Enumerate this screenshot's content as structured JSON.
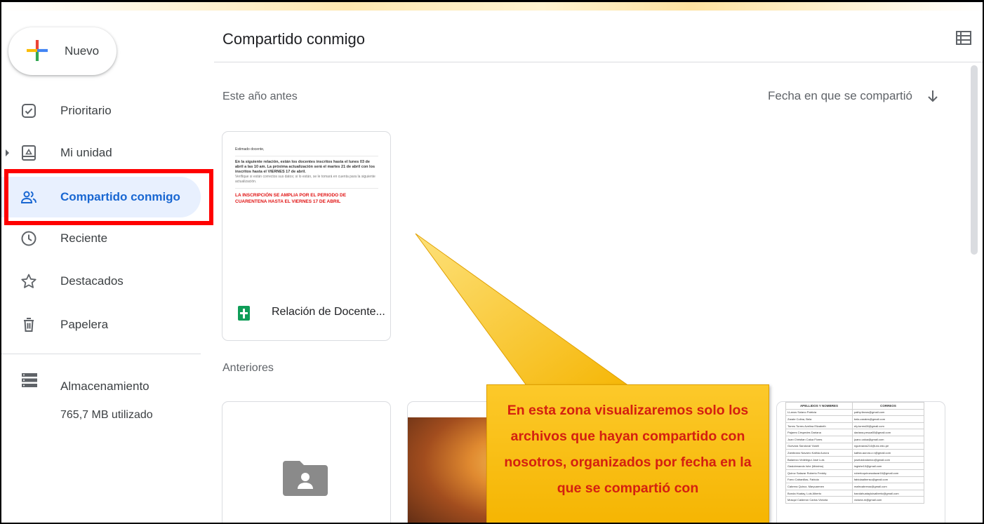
{
  "sidebar": {
    "new_button": "Nuevo",
    "items": [
      {
        "label": "Prioritario",
        "icon": "priority-check-icon"
      },
      {
        "label": "Mi unidad",
        "icon": "drive-icon"
      },
      {
        "label": "Compartido conmigo",
        "icon": "shared-people-icon",
        "active": true
      },
      {
        "label": "Reciente",
        "icon": "clock-icon"
      },
      {
        "label": "Destacados",
        "icon": "star-icon"
      },
      {
        "label": "Papelera",
        "icon": "trash-icon"
      }
    ],
    "storage": {
      "label": "Almacenamiento",
      "used": "765,7 MB utilizado"
    }
  },
  "main": {
    "title": "Compartido conmigo",
    "section_recent": "Este año antes",
    "sort_label": "Fecha en que se compartió",
    "section_older": "Anteriores",
    "files": [
      {
        "name": "Relación de Docente...",
        "type": "sheets"
      }
    ]
  },
  "doc_preview": {
    "line1": "Estimado docente,",
    "line2": "En la siguiente relación, están los docentes inscritos hasta el lunes 03 de abril a las 10 am. La próxima actualización será el martes 21 de abril con los inscritos hasta el VIERNES 17 de abril.",
    "line3": "Verifique si están correctos sus datos; si lo están, se le tomará en cuenta para la siguiente actualización.",
    "red_text": "LA INSCRIPCIÓN SE AMPLIA POR EL PERIODO DE CUARENTENA HASTA EL VIERNES 17 DE ABRIL"
  },
  "sheet_preview": {
    "headers": [
      "APELLIDOS Y NOMBRES",
      "CORREOS"
    ],
    "rows": [
      [
        "LLanos Solano Patricia",
        "pathy.llanos@gmail.com"
      ],
      [
        "Zarate Colina, Bela",
        "bela.zarates@gmail.com"
      ],
      [
        "Torres Torres Avelina Elizabeth",
        "ely.torres08@gmail.com"
      ],
      [
        "Pajares Céspedes Dariana",
        "dariana.pesua65@gmail.com"
      ],
      [
        "Juan Christian Calua Flores",
        "juanc.calua@gmail.com"
      ],
      [
        "Guevara Sandoval Yaneli",
        "nguevaras214@unc.edu.pe"
      ],
      [
        "Zambrano Navarro Kathia Aurora",
        "kathia.aurora.z.n@gmail.com"
      ],
      [
        "Balarezo Vedelegui José Luis",
        "joseluisbalarezo@gmail.com"
      ],
      [
        "Gaslobmando Ishe (Máximo)",
        "ingishe10@gmail.com"
      ],
      [
        "Quiroz Salazar Roberto Freddy",
        "robertoquirozsalazar16@gmail.com"
      ],
      [
        "Farro Cabanillas, Fabiola",
        "fabiolaalbenso@gmail.com"
      ],
      [
        "Cabrera Quiroz, Maryuarmen",
        "mafecabreraz@gmail.com"
      ],
      [
        "Bonda Huatay, Luis Alberto",
        "bandahuatayluisalberto@gmail.com"
      ],
      [
        "Mosqui Calderon Carlos Victoria",
        "victoria.m@gmail.com"
      ]
    ]
  },
  "callout": {
    "text": "En esta zona visualizaremos solo los archivos que hayan compartido con nosotros, organizados por fecha en la que se compartió con"
  },
  "colors": {
    "accent": "#1967d2",
    "highlight_box": "#ff0000",
    "callout_fill": "#f9bf12",
    "callout_text": "#d42010",
    "sheets_green": "#0f9d58"
  }
}
